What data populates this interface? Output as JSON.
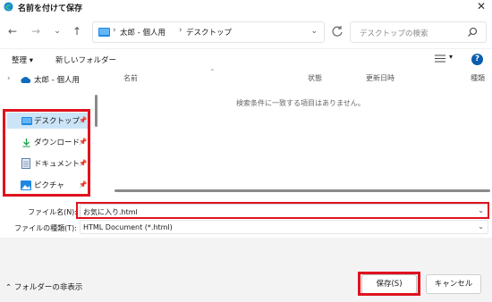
{
  "window": {
    "title": "名前を付けて保存"
  },
  "nav": {
    "breadcrumbs": [
      "太郎 - 個人用",
      "デスクトップ"
    ],
    "search_placeholder": "デスクトップの検索"
  },
  "toolbar": {
    "organize": "整理 ▾",
    "new_folder": "新しいフォルダー"
  },
  "sidebar": {
    "items": [
      {
        "label": "太郎 - 個人用",
        "icon": "onedrive-cloud-icon"
      },
      {
        "label": "デスクトップ",
        "icon": "desktop-folder-icon",
        "pinned": true,
        "selected": true
      },
      {
        "label": "ダウンロード",
        "icon": "download-icon",
        "pinned": true
      },
      {
        "label": "ドキュメント",
        "icon": "documents-icon",
        "pinned": true
      },
      {
        "label": "ピクチャ",
        "icon": "pictures-icon",
        "pinned": true
      }
    ]
  },
  "filelist": {
    "columns": [
      "名前",
      "状態",
      "更新日時",
      "種類"
    ],
    "empty_message": "検索条件に一致する項目はありません。"
  },
  "form": {
    "filename_label": "ファイル名(N):",
    "filename_value": "お気に入り.html",
    "filetype_label": "ファイルの種類(T):",
    "filetype_value": "HTML Document (*.html)"
  },
  "footer": {
    "hide_folders": "フォルダーの非表示",
    "save": "保存(S)",
    "cancel": "キャンセル"
  },
  "colors": {
    "highlight": "#e0121f",
    "folder_blue": "#1e88e5",
    "help_blue": "#0b5cad"
  }
}
